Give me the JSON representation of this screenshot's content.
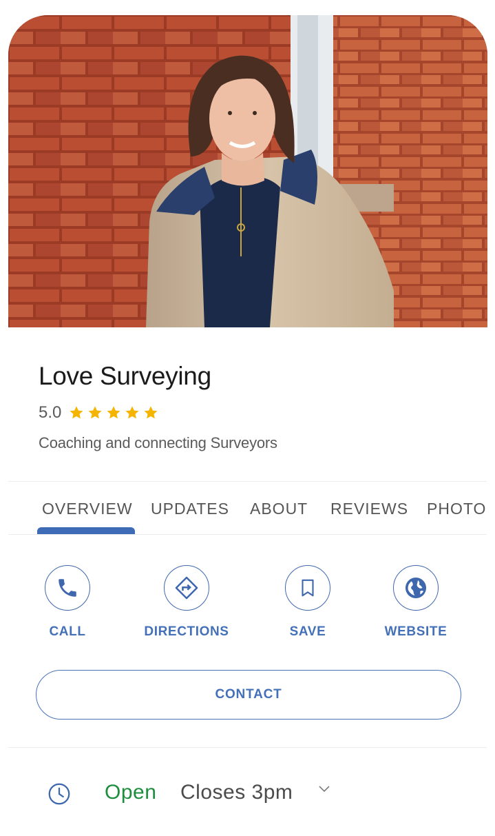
{
  "business": {
    "name": "Love Surveying",
    "rating": "5.0",
    "stars": 5,
    "tagline": "Coaching and connecting Surveyors"
  },
  "tabs": [
    {
      "label": "OVERVIEW",
      "active": true
    },
    {
      "label": "UPDATES",
      "active": false
    },
    {
      "label": "ABOUT",
      "active": false
    },
    {
      "label": "REVIEWS",
      "active": false
    },
    {
      "label": "PHOTO",
      "active": false
    }
  ],
  "actions": [
    {
      "label": "CALL",
      "icon": "phone-icon"
    },
    {
      "label": "DIRECTIONS",
      "icon": "directions-icon"
    },
    {
      "label": "SAVE",
      "icon": "bookmark-icon"
    },
    {
      "label": "WEBSITE",
      "icon": "globe-icon"
    }
  ],
  "contact_label": "CONTACT",
  "hours": {
    "status": "Open",
    "detail": "Closes 3pm"
  },
  "colors": {
    "accent": "#3d6bb5",
    "open": "#1e8e3e",
    "star": "#f4b400"
  }
}
